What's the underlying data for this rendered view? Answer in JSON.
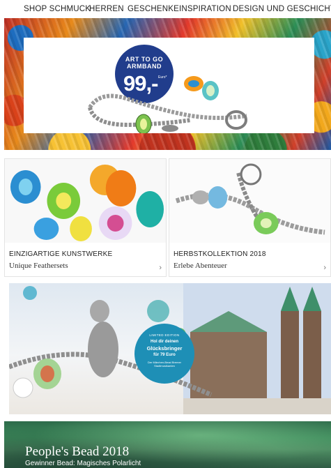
{
  "nav": {
    "items": [
      "SHOP SCHMUCK",
      "HERREN",
      "GESCHENKE",
      "INSPIRATION",
      "DESIGN UND GESCHICHTE"
    ]
  },
  "hero": {
    "badge_line1": "ART TO GO",
    "badge_line2": "ARMBAND",
    "price": "99,-",
    "currency": "Euro*",
    "badge_color": "#213d8c"
  },
  "tiles": [
    {
      "title": "EINZIGARTIGE KUNSTWERKE",
      "subtitle": "Unique Feathersets",
      "icon": "chevron-right-icon"
    },
    {
      "title": "HERBSTKOLLEKTION 2018",
      "subtitle": "Erlebe Abenteuer",
      "icon": "chevron-right-icon"
    }
  ],
  "promo": {
    "edition": "LIMITED EDITION",
    "line1": "Hol dir deinen",
    "line2": "Glücksbringer",
    "line3": "für 79 Euro",
    "line4": "Der Märchen-Bead Bremer Stadtmusikanten",
    "bubble_color": "#1e8fb6"
  },
  "peoples_bead": {
    "heading": "People's Bead 2018",
    "subheading": "Gewinner Bead: Magisches Polarlicht"
  }
}
